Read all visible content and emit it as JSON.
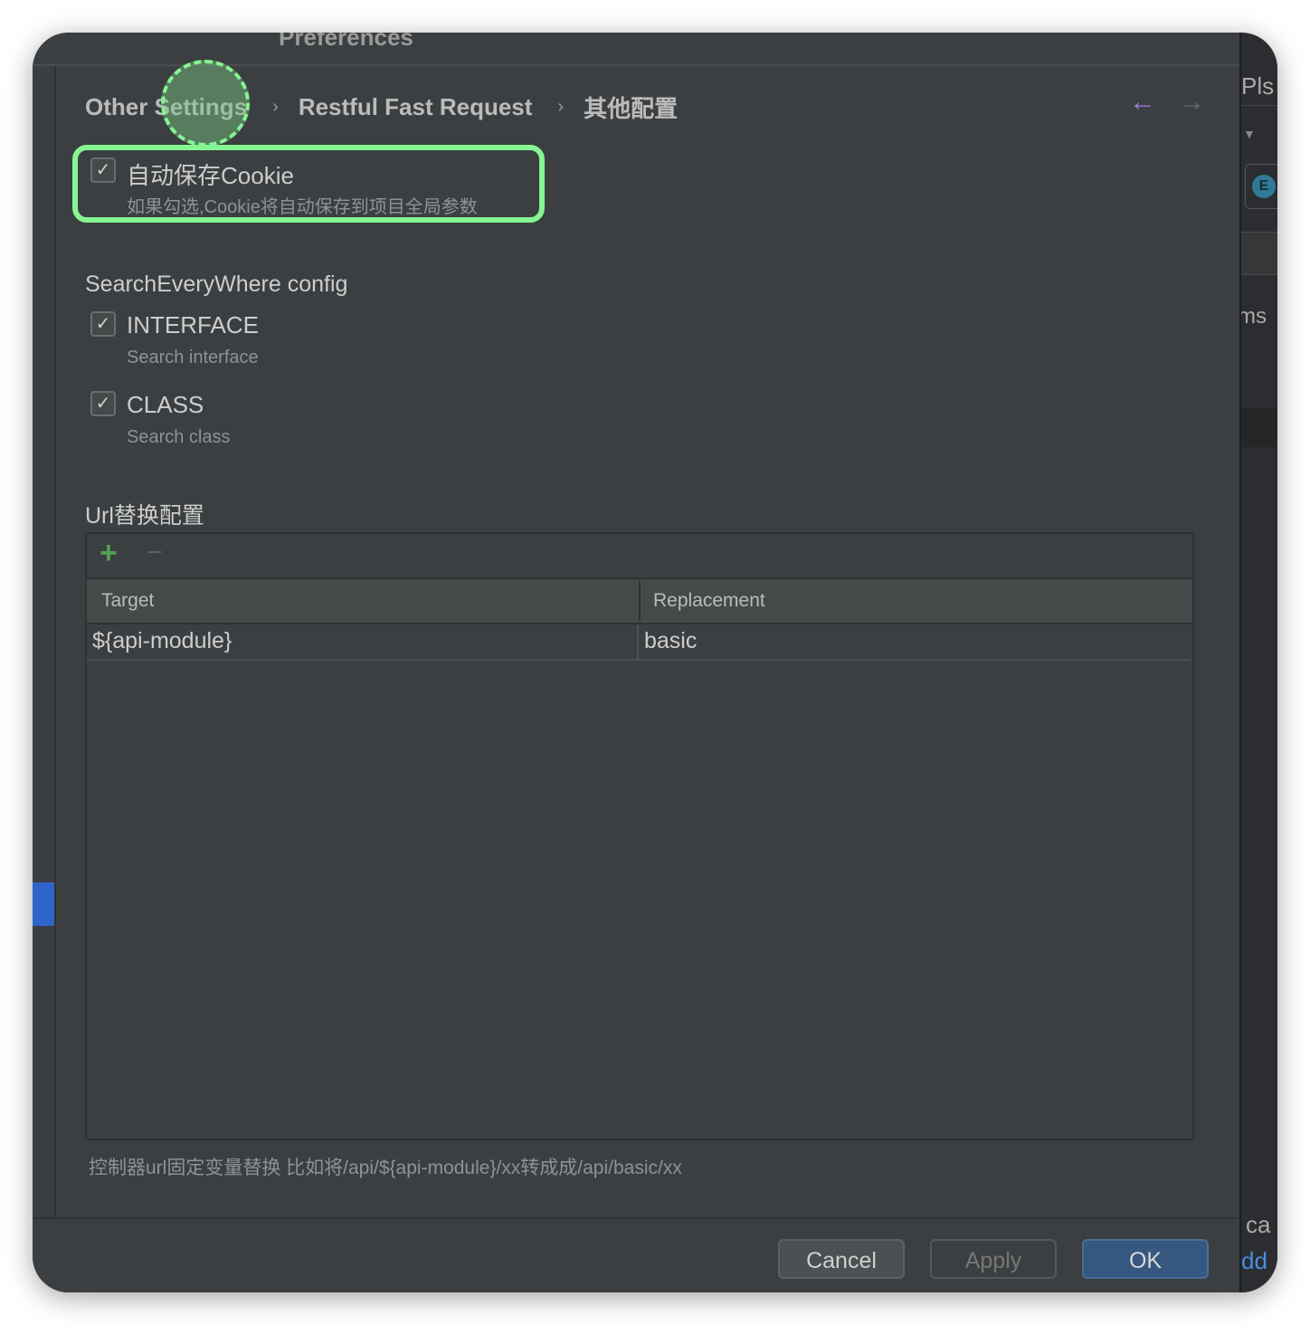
{
  "window": {
    "title": "Preferences"
  },
  "breadcrumb": [
    "Other Settings",
    "Restful Fast Request",
    "其他配置"
  ],
  "nav": {
    "back_icon": "arrow-left-icon",
    "forward_icon": "arrow-right-icon",
    "back_color": "#a07ee6"
  },
  "cookie": {
    "label": "自动保存Cookie",
    "description": "如果勾选,Cookie将自动保存到项目全局参数",
    "checked": true
  },
  "search_everywhere": {
    "title": "SearchEveryWhere config",
    "options": [
      {
        "label": "INTERFACE",
        "description": "Search interface",
        "checked": true
      },
      {
        "label": "CLASS",
        "description": "Search class",
        "checked": true
      }
    ]
  },
  "url_replace": {
    "title": "Url替换配置",
    "toolbar": {
      "add": "+",
      "remove": "−"
    },
    "columns": [
      "Target",
      "Replacement"
    ],
    "rows": [
      [
        "${api-module}",
        "basic"
      ]
    ],
    "note": "控制器url固定变量替换 比如将/api/${api-module}/xx转成成/api/basic/xx"
  },
  "buttons": {
    "cancel": "Cancel",
    "apply": "Apply",
    "ok": "OK"
  },
  "background_window": {
    "fragments": [
      "Pls",
      "E",
      "ms",
      "ca",
      "dd"
    ]
  },
  "colors": {
    "accent": "#365880",
    "highlight": "#86f593",
    "add_green": "#4fa24f"
  }
}
